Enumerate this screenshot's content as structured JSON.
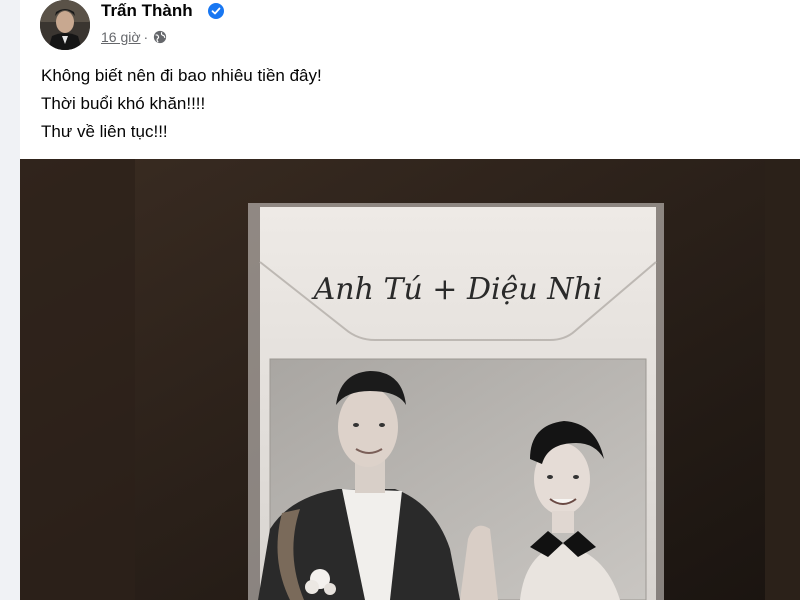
{
  "post": {
    "author": "Trấn Thành",
    "verified": true,
    "timestamp": "16 giờ",
    "separator": "·",
    "privacy_icon": "globe-icon",
    "lines": [
      "Không biết nên đi bao nhiêu tiền đây!",
      "Thời buổi khó khăn!!!!",
      "Thư về liên tục!!!"
    ]
  },
  "photo": {
    "envelope_signature": "Anh Tú + Diệu Nhi"
  },
  "colors": {
    "verified_blue": "#1877f2",
    "text_primary": "#050505",
    "text_secondary": "#65676b"
  }
}
